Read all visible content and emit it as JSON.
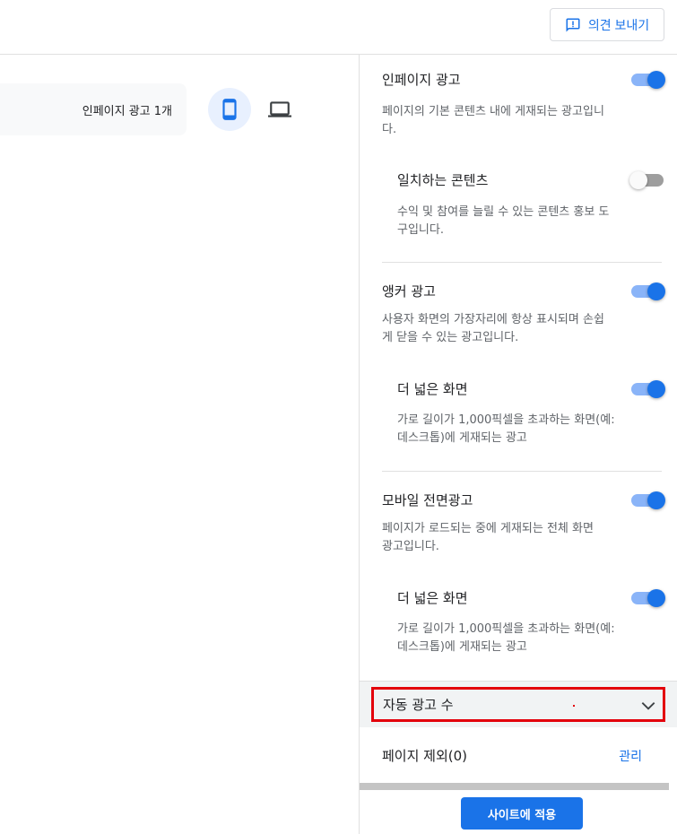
{
  "header": {
    "feedback_label": "의견 보내기"
  },
  "preview": {
    "inpage_count_label": "인페이지 광고 1개"
  },
  "settings": {
    "inpage": {
      "title": "인페이지 광고",
      "desc": "페이지의 기본 콘텐츠 내에 게재되는 광고입니다.",
      "enabled": true,
      "matched_content": {
        "title": "일치하는 콘텐츠",
        "desc": "수익 및 참여를 늘릴 수 있는 콘텐츠 홍보 도구입니다.",
        "enabled": false
      }
    },
    "anchor": {
      "title": "앵커 광고",
      "desc": "사용자 화면의 가장자리에 항상 표시되며 손쉽게 닫을 수 있는 광고입니다.",
      "enabled": true,
      "wider": {
        "title": "더 넓은 화면",
        "desc": "가로 길이가 1,000픽셀을 초과하는 화면(예: 데스크톱)에 게재되는 광고",
        "enabled": true
      }
    },
    "vignette": {
      "title": "모바일 전면광고",
      "desc": "페이지가 로드되는 중에 게재되는 전체 화면 광고입니다.",
      "enabled": true,
      "wider": {
        "title": "더 넓은 화면",
        "desc": "가로 길이가 1,000픽셀을 초과하는 화면(예: 데스크톱)에 게재되는 광고",
        "enabled": true
      }
    },
    "auto_ad_count": {
      "label": "자동 광고 수"
    },
    "exclusions": {
      "label": "페이지 제외(0)",
      "manage_label": "관리"
    },
    "apply_label": "사이트에 적용"
  },
  "colors": {
    "accent": "#1a73e8",
    "highlight": "#e3000b"
  }
}
